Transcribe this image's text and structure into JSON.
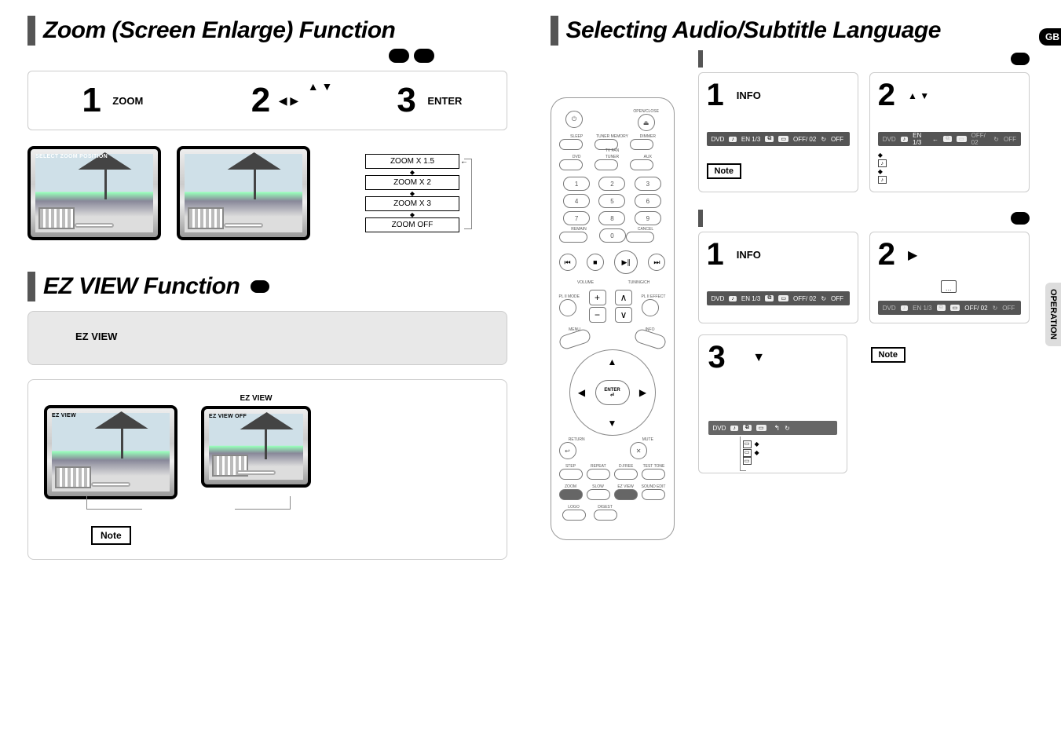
{
  "lang_badge": "GB",
  "side_tab": "OPERATION",
  "left": {
    "zoom_title": "Zoom (Screen Enlarge) Function",
    "steps": {
      "s1": {
        "num": "1",
        "label": "ZOOM"
      },
      "s2": {
        "num": "2",
        "arrows_h": "◀ ▶",
        "arrows_v": "▲ ▼"
      },
      "s3": {
        "num": "3",
        "label": "ENTER"
      }
    },
    "tv1_caption": "SELECT ZOOM POSITION",
    "zoomlist": {
      "z1": "ZOOM X 1.5",
      "z2": "ZOOM X 2",
      "z3": "ZOOM X 3",
      "z4": "ZOOM  OFF"
    },
    "ez_title": "EZ VIEW Function",
    "ez_label_big": "EZ VIEW",
    "ez_cap_top": "EZ VIEW",
    "tv_ezview": "EZ VIEW",
    "tv_ezview_off": "EZ VIEW OFF",
    "note": "Note"
  },
  "right": {
    "title": "Selecting Audio/Subtitle Language",
    "sec1": {
      "s1": {
        "num": "1",
        "label": "INFO"
      },
      "s2": {
        "num": "2",
        "arrows": "▲ ▼"
      },
      "osd_main": {
        "dvd": "DVD",
        "audio_chip": "EN 1/3",
        "angle_icon": "",
        "sub": "OFF/ 02",
        "repeat": "OFF"
      },
      "osd_right_top": {
        "dvd": "DVD",
        "audio_chip": "EN 1/3",
        "angle_dim": "",
        "sub_dim": "OFF/ 02",
        "repeat_dim": "OFF"
      },
      "note": "Note"
    },
    "sec2": {
      "s1": {
        "num": "1",
        "label": "INFO"
      },
      "s2": {
        "num": "2",
        "arrow": "▶"
      },
      "osd_left": {
        "dvd": "DVD",
        "audio_chip": "EN 1/3",
        "sub": "OFF/ 02",
        "repeat": "OFF"
      },
      "osd_right": {
        "dvd_dim": "DVD",
        "audio_dim": "EN 1/3",
        "sub": "OFF/ 02",
        "repeat_dim": "OFF"
      }
    },
    "sec3": {
      "num": "3",
      "arrow": "▼",
      "osd": {
        "dvd_dim": "DVD"
      },
      "note": "Note"
    }
  },
  "remote": {
    "top_labels": {
      "open_close": "OPEN/CLOSE"
    },
    "row2": {
      "sleep": "SLEEP",
      "tuner_mem": "TUNER MEMORY",
      "tv_fan": "TV FAN",
      "dimmer": "DIMMER"
    },
    "row3": {
      "dvd": "DVD",
      "tuner": "TUNER",
      "aux": "AUX"
    },
    "nums": [
      "1",
      "2",
      "3",
      "4",
      "5",
      "6",
      "7",
      "8",
      "9",
      "0"
    ],
    "remain": "REMAIN",
    "cancel": "CANCEL",
    "volume": "VOLUME",
    "tuning_ch": "TUNING/CH",
    "plii_mode": "PL II MODE",
    "plii_effect": "PL II EFFECT",
    "menu": "MENU",
    "info": "INFO",
    "enter": "ENTER",
    "return": "RETURN",
    "mute": "MUTE",
    "bottom_row1": {
      "step": "STEP",
      "repeat": "REPEAT",
      "dfree": "D.FREE",
      "test_tone": "TEST TONE"
    },
    "bottom_row2": {
      "zoom": "ZOOM",
      "slow": "SLOW",
      "ezview": "EZ VIEW",
      "sound_edit": "SOUND EDIT"
    },
    "bottom_row3": {
      "logo": "LOGO",
      "digest": "DIGEST"
    }
  }
}
